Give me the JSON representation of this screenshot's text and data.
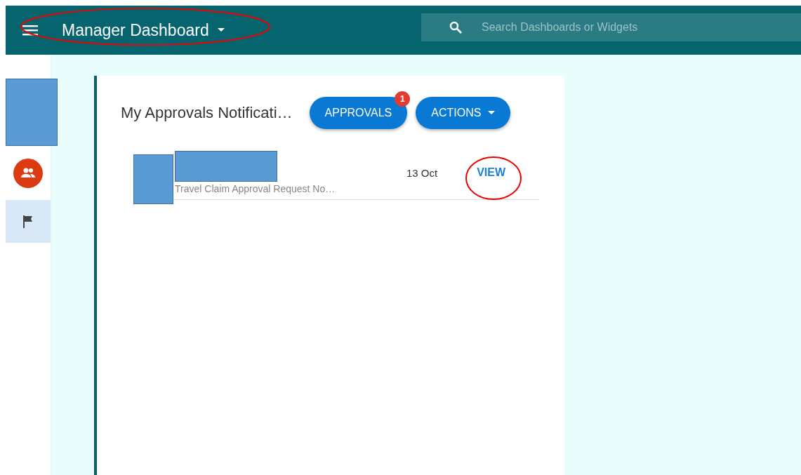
{
  "header": {
    "title": "Manager Dashboard",
    "search": {
      "placeholder": "Search Dashboards or Widgets"
    }
  },
  "sidebar": {
    "items": [
      {
        "kind": "people",
        "selected": false
      },
      {
        "kind": "flag",
        "selected": true
      }
    ]
  },
  "card": {
    "title": "My Approvals Notificati…",
    "buttons": [
      {
        "label": "APPROVALS",
        "badge": "1",
        "kind": "badge"
      },
      {
        "label": "ACTIONS",
        "kind": "dropdown"
      }
    ],
    "notifications": [
      {
        "subtitle": "Travel Claim Approval Request No…",
        "date": "13 Oct",
        "action": "VIEW"
      }
    ]
  }
}
